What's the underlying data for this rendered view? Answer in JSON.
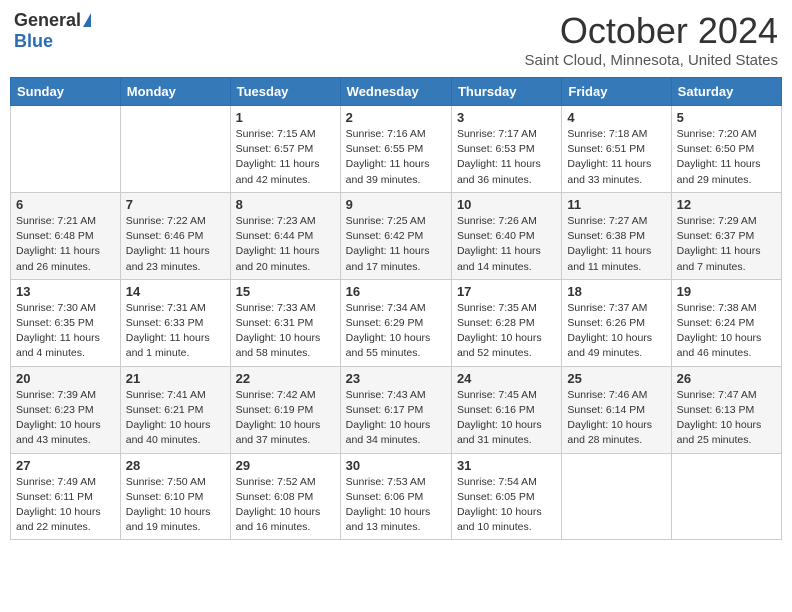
{
  "header": {
    "logo_general": "General",
    "logo_blue": "Blue",
    "title": "October 2024",
    "subtitle": "Saint Cloud, Minnesota, United States"
  },
  "weekdays": [
    "Sunday",
    "Monday",
    "Tuesday",
    "Wednesday",
    "Thursday",
    "Friday",
    "Saturday"
  ],
  "weeks": [
    [
      {
        "day": "",
        "info": ""
      },
      {
        "day": "",
        "info": ""
      },
      {
        "day": "1",
        "info": "Sunrise: 7:15 AM\nSunset: 6:57 PM\nDaylight: 11 hours and 42 minutes."
      },
      {
        "day": "2",
        "info": "Sunrise: 7:16 AM\nSunset: 6:55 PM\nDaylight: 11 hours and 39 minutes."
      },
      {
        "day": "3",
        "info": "Sunrise: 7:17 AM\nSunset: 6:53 PM\nDaylight: 11 hours and 36 minutes."
      },
      {
        "day": "4",
        "info": "Sunrise: 7:18 AM\nSunset: 6:51 PM\nDaylight: 11 hours and 33 minutes."
      },
      {
        "day": "5",
        "info": "Sunrise: 7:20 AM\nSunset: 6:50 PM\nDaylight: 11 hours and 29 minutes."
      }
    ],
    [
      {
        "day": "6",
        "info": "Sunrise: 7:21 AM\nSunset: 6:48 PM\nDaylight: 11 hours and 26 minutes."
      },
      {
        "day": "7",
        "info": "Sunrise: 7:22 AM\nSunset: 6:46 PM\nDaylight: 11 hours and 23 minutes."
      },
      {
        "day": "8",
        "info": "Sunrise: 7:23 AM\nSunset: 6:44 PM\nDaylight: 11 hours and 20 minutes."
      },
      {
        "day": "9",
        "info": "Sunrise: 7:25 AM\nSunset: 6:42 PM\nDaylight: 11 hours and 17 minutes."
      },
      {
        "day": "10",
        "info": "Sunrise: 7:26 AM\nSunset: 6:40 PM\nDaylight: 11 hours and 14 minutes."
      },
      {
        "day": "11",
        "info": "Sunrise: 7:27 AM\nSunset: 6:38 PM\nDaylight: 11 hours and 11 minutes."
      },
      {
        "day": "12",
        "info": "Sunrise: 7:29 AM\nSunset: 6:37 PM\nDaylight: 11 hours and 7 minutes."
      }
    ],
    [
      {
        "day": "13",
        "info": "Sunrise: 7:30 AM\nSunset: 6:35 PM\nDaylight: 11 hours and 4 minutes."
      },
      {
        "day": "14",
        "info": "Sunrise: 7:31 AM\nSunset: 6:33 PM\nDaylight: 11 hours and 1 minute."
      },
      {
        "day": "15",
        "info": "Sunrise: 7:33 AM\nSunset: 6:31 PM\nDaylight: 10 hours and 58 minutes."
      },
      {
        "day": "16",
        "info": "Sunrise: 7:34 AM\nSunset: 6:29 PM\nDaylight: 10 hours and 55 minutes."
      },
      {
        "day": "17",
        "info": "Sunrise: 7:35 AM\nSunset: 6:28 PM\nDaylight: 10 hours and 52 minutes."
      },
      {
        "day": "18",
        "info": "Sunrise: 7:37 AM\nSunset: 6:26 PM\nDaylight: 10 hours and 49 minutes."
      },
      {
        "day": "19",
        "info": "Sunrise: 7:38 AM\nSunset: 6:24 PM\nDaylight: 10 hours and 46 minutes."
      }
    ],
    [
      {
        "day": "20",
        "info": "Sunrise: 7:39 AM\nSunset: 6:23 PM\nDaylight: 10 hours and 43 minutes."
      },
      {
        "day": "21",
        "info": "Sunrise: 7:41 AM\nSunset: 6:21 PM\nDaylight: 10 hours and 40 minutes."
      },
      {
        "day": "22",
        "info": "Sunrise: 7:42 AM\nSunset: 6:19 PM\nDaylight: 10 hours and 37 minutes."
      },
      {
        "day": "23",
        "info": "Sunrise: 7:43 AM\nSunset: 6:17 PM\nDaylight: 10 hours and 34 minutes."
      },
      {
        "day": "24",
        "info": "Sunrise: 7:45 AM\nSunset: 6:16 PM\nDaylight: 10 hours and 31 minutes."
      },
      {
        "day": "25",
        "info": "Sunrise: 7:46 AM\nSunset: 6:14 PM\nDaylight: 10 hours and 28 minutes."
      },
      {
        "day": "26",
        "info": "Sunrise: 7:47 AM\nSunset: 6:13 PM\nDaylight: 10 hours and 25 minutes."
      }
    ],
    [
      {
        "day": "27",
        "info": "Sunrise: 7:49 AM\nSunset: 6:11 PM\nDaylight: 10 hours and 22 minutes."
      },
      {
        "day": "28",
        "info": "Sunrise: 7:50 AM\nSunset: 6:10 PM\nDaylight: 10 hours and 19 minutes."
      },
      {
        "day": "29",
        "info": "Sunrise: 7:52 AM\nSunset: 6:08 PM\nDaylight: 10 hours and 16 minutes."
      },
      {
        "day": "30",
        "info": "Sunrise: 7:53 AM\nSunset: 6:06 PM\nDaylight: 10 hours and 13 minutes."
      },
      {
        "day": "31",
        "info": "Sunrise: 7:54 AM\nSunset: 6:05 PM\nDaylight: 10 hours and 10 minutes."
      },
      {
        "day": "",
        "info": ""
      },
      {
        "day": "",
        "info": ""
      }
    ]
  ]
}
